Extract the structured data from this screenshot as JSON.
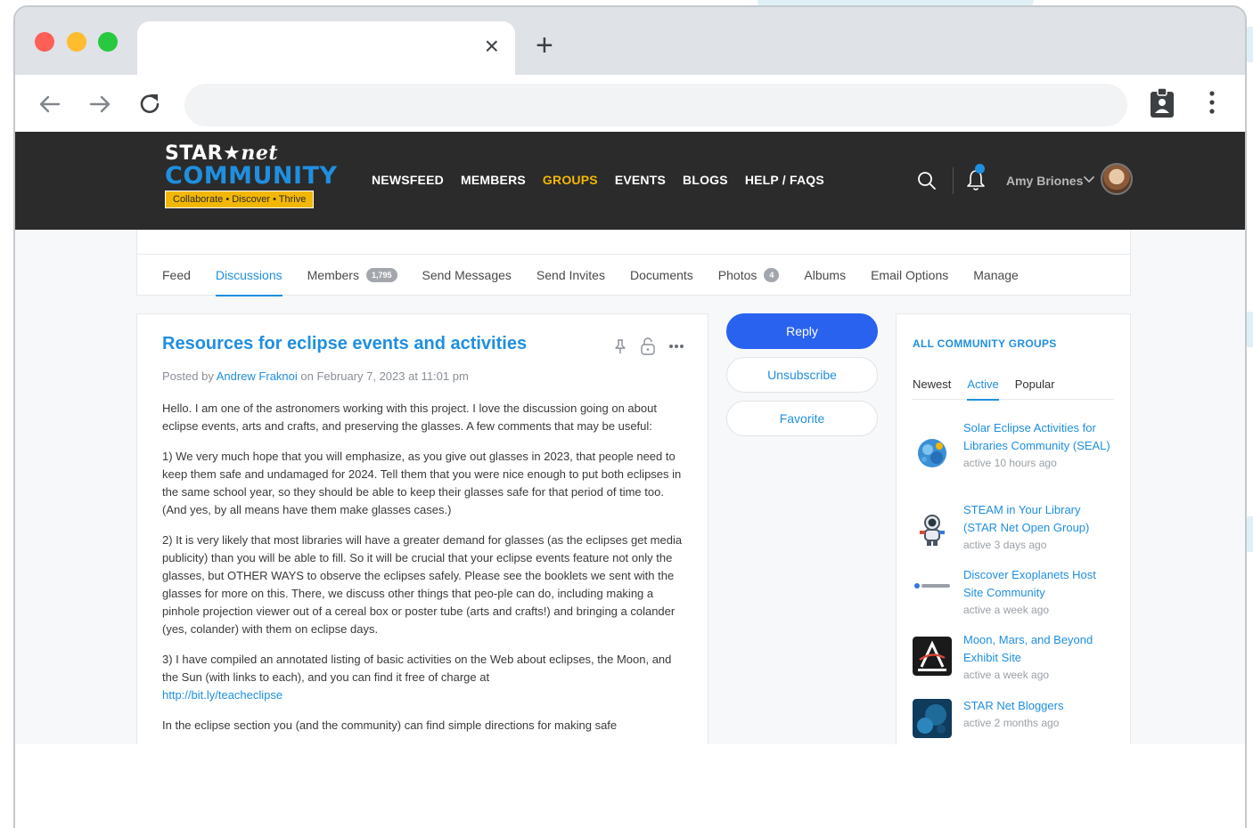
{
  "browser": {
    "tab_close": "×",
    "new_tab": "+"
  },
  "site": {
    "logo": {
      "star": "STAR",
      "net": "net",
      "community": "COMMUNITY",
      "tagline": "Collaborate • Discover • Thrive"
    },
    "nav": [
      "NEWSFEED",
      "MEMBERS",
      "GROUPS",
      "EVENTS",
      "BLOGS",
      "HELP / FAQS"
    ],
    "nav_active": "GROUPS",
    "user": "Amy Briones",
    "accent": "#1f8fe0",
    "highlight": "#f2b705"
  },
  "subnav": {
    "items": [
      {
        "label": "Feed"
      },
      {
        "label": "Discussions",
        "active": true
      },
      {
        "label": "Members",
        "badge": "1,795"
      },
      {
        "label": "Send Messages"
      },
      {
        "label": "Send Invites"
      },
      {
        "label": "Documents"
      },
      {
        "label": "Photos",
        "badge": "4"
      },
      {
        "label": "Albums"
      },
      {
        "label": "Email Options"
      },
      {
        "label": "Manage"
      }
    ]
  },
  "post": {
    "title": "Resources for eclipse events and activities",
    "meta_prefix": "Posted by",
    "author": "Andrew Fraknoi",
    "meta_suffix": "on February 7, 2023 at 11:01 pm",
    "paragraphs": [
      "Hello. I am one of the astronomers working with this project. I love the discussion going on about eclipse events, arts and crafts, and preserving the glasses. A few comments that may be useful:",
      "1) We very much hope that you will emphasize, as you give out glasses in 2023, that people need to keep them safe and undamaged for 2024. Tell them that you were nice enough to put both eclipses in the same school year, so they should be able to keep their glasses safe for that period of time too. (And yes, by all means have them make glasses cases.)",
      "2) It is very likely that most libraries will have a greater demand for glasses (as the eclipses get media publicity) than you will be able to fill. So it will be crucial that your eclipse events feature not only the glasses, but OTHER WAYS to observe the eclipses safely. Please see the booklets we sent with the glasses for more on this. There, we discuss other things that peo-ple can do, including making a pinhole projection viewer out of a cereal box or poster tube (arts and crafts!) and bringing a colander (yes, colander) with them on eclipse days.",
      "3) I have compiled an annotated listing of basic activities on the Web about eclipses, the Moon, and the Sun (with links to each), and you can find it free of charge at"
    ],
    "link": "http://bit.ly/teacheclipse",
    "last_paragraph": "In the eclipse section you (and the community) can find simple directions for making safe"
  },
  "actions": {
    "reply": "Reply",
    "unsubscribe": "Unsubscribe",
    "favorite": "Favorite"
  },
  "sidebar": {
    "title": "ALL COMMUNITY GROUPS",
    "tabs": [
      "Newest",
      "Active",
      "Popular"
    ],
    "active_tab": "Active",
    "groups": [
      {
        "name": "Solar Eclipse Activities for Libraries Community (SEAL)",
        "activity": "active 10 hours ago",
        "icon": "seal-logo-icon"
      },
      {
        "name": "STEAM in Your Library (STAR Net Open Group)",
        "activity": "active 3 days ago",
        "icon": "astronaut-icon"
      },
      {
        "name": "Discover Exoplanets Host Site Community",
        "activity": "active a week ago",
        "icon": "discover-logo-icon"
      },
      {
        "name": "Moon, Mars, and Beyond Exhibit Site",
        "activity": "active a week ago",
        "icon": "artemis-logo-icon"
      },
      {
        "name": "STAR Net Bloggers",
        "activity": "active 2 months ago",
        "icon": "bloggers-thumb-icon"
      }
    ]
  }
}
